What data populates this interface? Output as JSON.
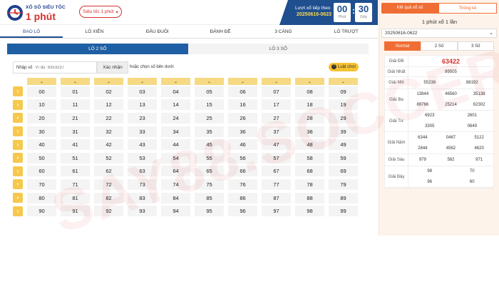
{
  "logo": {
    "small": "XỔ SỐ SIÊU TỐC",
    "big": "1 phút"
  },
  "game_select": {
    "label": "Siêu tốc 1 phút"
  },
  "timer": {
    "caption": "Lượt xổ tiếp theo",
    "draw_id": "20250616-0623",
    "minutes": "00",
    "minutes_unit": "Phút",
    "seconds": "30",
    "seconds_unit": "Giây"
  },
  "nav": {
    "tabs": [
      "BAO LÔ",
      "LÔ XIÊN",
      "ĐẦU ĐUÔI",
      "ĐÁNH ĐỀ",
      "3 CÀNG",
      "LÔ TRƯỢT"
    ],
    "active": 0
  },
  "subtabs": {
    "items": [
      "LÔ 2 SỐ",
      "LÔ 3 SỐ"
    ],
    "active": 0
  },
  "entry": {
    "label": "Nhập số",
    "placeholder": "Ví dụ: 8353237",
    "confirm": "Xác nhận",
    "hint": "hoặc chọn số bên dưới",
    "rules": "Luật chơi"
  },
  "numbers": [
    [
      "00",
      "01",
      "02",
      "03",
      "04",
      "05",
      "06",
      "07",
      "08",
      "09"
    ],
    [
      "10",
      "11",
      "12",
      "13",
      "14",
      "15",
      "16",
      "17",
      "18",
      "19"
    ],
    [
      "20",
      "21",
      "22",
      "23",
      "24",
      "25",
      "26",
      "27",
      "28",
      "29"
    ],
    [
      "30",
      "31",
      "32",
      "33",
      "34",
      "35",
      "36",
      "37",
      "38",
      "39"
    ],
    [
      "40",
      "41",
      "42",
      "43",
      "44",
      "45",
      "46",
      "47",
      "48",
      "49"
    ],
    [
      "50",
      "51",
      "52",
      "53",
      "54",
      "55",
      "56",
      "57",
      "58",
      "59"
    ],
    [
      "60",
      "61",
      "62",
      "63",
      "64",
      "65",
      "66",
      "67",
      "68",
      "69"
    ],
    [
      "70",
      "71",
      "72",
      "73",
      "74",
      "75",
      "76",
      "77",
      "78",
      "79"
    ],
    [
      "80",
      "81",
      "82",
      "83",
      "84",
      "85",
      "86",
      "87",
      "88",
      "89"
    ],
    [
      "90",
      "91",
      "92",
      "93",
      "94",
      "95",
      "96",
      "97",
      "98",
      "99"
    ]
  ],
  "results": {
    "tabs": [
      "Kết quả xổ số",
      "Thống kê"
    ],
    "title": "1 phút xổ 1 lần",
    "draw_select": "20250616-0622",
    "mode_tabs": [
      "Normal",
      "2 Số",
      "3 Số"
    ],
    "rows": [
      {
        "label": "Giải ĐB",
        "values": [
          "63422"
        ]
      },
      {
        "label": "Giải Nhất",
        "values": [
          "89505"
        ]
      },
      {
        "label": "Giải Nhì",
        "values": [
          "55238",
          "88192"
        ]
      },
      {
        "label": "Giải Ba",
        "values": [
          "13844",
          "46560",
          "35138",
          "89766",
          "25214",
          "62302"
        ]
      },
      {
        "label": "Giải Tư",
        "values": [
          "6923",
          "2601",
          "3305",
          "0649"
        ]
      },
      {
        "label": "Giải Năm",
        "values": [
          "6344",
          "0467",
          "5122",
          "2844",
          "4562",
          "4620"
        ]
      },
      {
        "label": "Giải Sáu",
        "values": [
          "979",
          "582",
          "971"
        ]
      },
      {
        "label": "Giải Bảy",
        "values": [
          "98",
          "70",
          "96",
          "60"
        ]
      }
    ]
  },
  "watermark": "SAY88.SOCCER",
  "colors": {
    "accent_blue": "#1f4f8f",
    "accent_red": "#d62f2f",
    "accent_orange": "#f06e33",
    "header_yellow": "#f6d983"
  }
}
